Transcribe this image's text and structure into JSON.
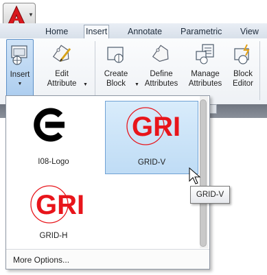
{
  "app_button": {
    "logo_letter": "A"
  },
  "tabs": [
    {
      "label": "Home",
      "active": false
    },
    {
      "label": "Insert",
      "active": true
    },
    {
      "label": "Annotate",
      "active": false
    },
    {
      "label": "Parametric",
      "active": false
    },
    {
      "label": "View",
      "active": false
    }
  ],
  "ribbon": {
    "insert": {
      "label": "Insert",
      "icon": "insert-block-icon"
    },
    "edit_attribute": {
      "line1": "Edit",
      "line2": "Attribute",
      "icon": "edit-attribute-icon"
    },
    "create_block": {
      "line1": "Create",
      "line2": "Block",
      "icon": "create-block-icon"
    },
    "define_attributes": {
      "line1": "Define",
      "line2": "Attributes",
      "icon": "define-attributes-icon"
    },
    "manage_attributes": {
      "line1": "Manage",
      "line2": "Attributes",
      "icon": "manage-attributes-icon"
    },
    "block_editor": {
      "line1": "Block",
      "line2": "Editor",
      "icon": "block-editor-icon"
    }
  },
  "gallery": {
    "items": [
      {
        "name": "I08-Logo",
        "preview": "logo-preview-icon",
        "selected": false
      },
      {
        "name": "GRID-V",
        "preview_text": "GRI",
        "selected": true
      },
      {
        "name": "GRID-H",
        "preview_text": "GRI",
        "selected": false
      }
    ],
    "more_options": "More Options..."
  },
  "tooltip": {
    "text": "GRID-V"
  },
  "colors": {
    "accent_red": "#e8151b",
    "selection_blue": "#bfdcf5"
  }
}
